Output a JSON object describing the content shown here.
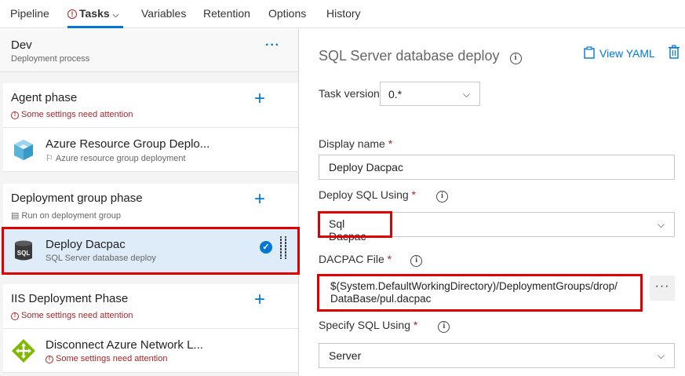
{
  "nav": {
    "tabs": [
      {
        "label": "Pipeline"
      },
      {
        "label": "Tasks"
      },
      {
        "label": "Variables"
      },
      {
        "label": "Retention"
      },
      {
        "label": "Options"
      },
      {
        "label": "History"
      }
    ]
  },
  "env": {
    "title": "Dev",
    "subtitle": "Deployment process",
    "more": "···"
  },
  "phases": [
    {
      "title": "Agent phase",
      "subtitle": "Some settings need attention"
    },
    {
      "title": "Deployment group phase",
      "subtitle": "Run on deployment group"
    },
    {
      "title": "IIS Deployment Phase",
      "subtitle": "Some settings need attention"
    }
  ],
  "tasks": [
    {
      "title": "Azure Resource Group Deplo...",
      "subtitle": "Azure resource group deployment"
    },
    {
      "title": "Deploy Dacpac",
      "subtitle": "SQL Server database deploy"
    },
    {
      "title": "Disconnect Azure Network L...",
      "subtitle": "Some settings need attention"
    }
  ],
  "detail": {
    "title": "SQL Server database deploy",
    "view_yaml": "View YAML",
    "task_version_label": "Task version",
    "task_version_value": "0.*",
    "display_name_label": "Display name",
    "display_name_value": "Deploy Dacpac",
    "deploy_sql_using_label": "Deploy SQL Using",
    "deploy_sql_using_value": "Sql Dacpac",
    "dacpac_file_label": "DACPAC File",
    "dacpac_file_line1": "$(System.DefaultWorkingDirectory)/DeploymentGroups/drop/",
    "dacpac_file_line2": "DataBase/pul.dacpac",
    "specify_sql_using_label": "Specify SQL Using",
    "specify_sql_using_value": "Server",
    "required_mark": "*",
    "browse": "···"
  },
  "colors": {
    "accent": "#0078d4",
    "error": "#a4262c",
    "highlight_box": "#e00000",
    "selected_bg": "#deecf9"
  }
}
